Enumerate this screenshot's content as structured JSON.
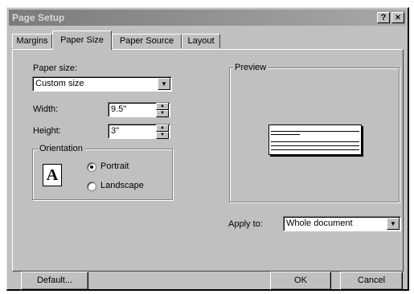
{
  "window": {
    "title": "Page Setup",
    "help_button": "?",
    "close_button": "×"
  },
  "tabs": [
    {
      "label": "Margins"
    },
    {
      "label": "Paper Size",
      "active": true
    },
    {
      "label": "Paper Source"
    },
    {
      "label": "Layout"
    }
  ],
  "paper": {
    "paper_size_label": "Paper size:",
    "paper_size_value": "Custom size",
    "width_label": "Width:",
    "width_value": "9.5\"",
    "height_label": "Height:",
    "height_value": "3\""
  },
  "orientation": {
    "title": "Orientation",
    "icon_letter": "A",
    "portrait_label": "Portrait",
    "landscape_label": "Landscape",
    "selected": "portrait"
  },
  "preview": {
    "title": "Preview"
  },
  "apply": {
    "label": "Apply to:",
    "value": "Whole document"
  },
  "buttons": {
    "default": "Default...",
    "ok": "OK",
    "cancel": "Cancel"
  },
  "colors": {
    "dialog_face": "#c0c0c0",
    "title_bar": "#7b7b7b"
  }
}
